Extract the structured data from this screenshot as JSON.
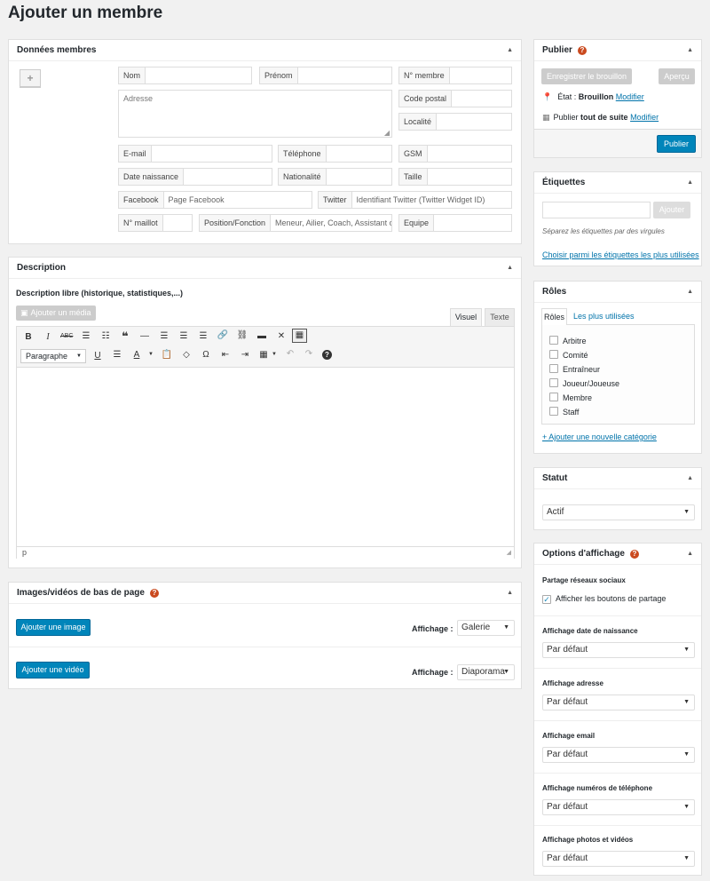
{
  "page": {
    "title": "Ajouter un membre"
  },
  "member": {
    "header": "Données membres",
    "add_symbol": "+",
    "fields": {
      "nom": "Nom",
      "prenom": "Prénom",
      "numero": "N° membre",
      "adresse": "Adresse",
      "code_postal": "Code postal",
      "localite": "Localité",
      "email": "E-mail",
      "telephone": "Téléphone",
      "gsm": "GSM",
      "date_naissance": "Date naissance",
      "nationalite": "Nationalité",
      "taille": "Taille",
      "facebook": "Facebook",
      "facebook_ph": "Page Facebook",
      "twitter": "Twitter",
      "twitter_ph": "Identifiant Twitter (Twitter Widget ID)",
      "maillot": "N° maillot",
      "position": "Position/Fonction",
      "position_ph": "Meneur, Ailier, Coach, Assistant co",
      "equipe": "Equipe"
    }
  },
  "description": {
    "header": "Description",
    "label": "Description libre (historique, statistiques,...)",
    "add_media": "Ajouter un média",
    "tab_visuel": "Visuel",
    "tab_texte": "Texte",
    "format": "Paragraphe",
    "status": "p"
  },
  "media": {
    "header": "Images/vidéos de bas de page",
    "add_image": "Ajouter une image",
    "add_video": "Ajouter une vidéo",
    "affichage": "Affichage :",
    "image_value": "Galerie",
    "video_value": "Diaporama"
  },
  "publish": {
    "header": "Publier",
    "save_draft": "Enregistrer le brouillon",
    "preview": "Aperçu",
    "state_label": "État :",
    "state_value": "Brouillon",
    "modify": "Modifier",
    "publish_label": "Publier",
    "publish_when": "tout de suite",
    "publish_btn": "Publier"
  },
  "tags": {
    "header": "Étiquettes",
    "add": "Ajouter",
    "hint": "Séparez les étiquettes par des virgules",
    "choose": "Choisir parmi les étiquettes les plus utilisées"
  },
  "roles": {
    "header": "Rôles",
    "tab_all": "Rôles",
    "tab_popular": "Les plus utilisées",
    "items": [
      "Arbitre",
      "Comité",
      "Entraîneur",
      "Joueur/Joueuse",
      "Membre",
      "Staff"
    ],
    "add_new": "+ Ajouter une nouvelle catégorie"
  },
  "statut": {
    "header": "Statut",
    "value": "Actif"
  },
  "display": {
    "header": "Options d'affichage",
    "social_label": "Partage réseaux sociaux",
    "social_cb": "Afficher les boutons de partage",
    "default": "Par défaut",
    "birth": "Affichage date de naissance",
    "address": "Affichage adresse",
    "email": "Affichage email",
    "phones": "Affichage numéros de téléphone",
    "photos": "Affichage photos et vidéos"
  },
  "colors": {
    "accent": "#0085ba",
    "help": "#ca4a1f",
    "link": "#0073aa"
  }
}
